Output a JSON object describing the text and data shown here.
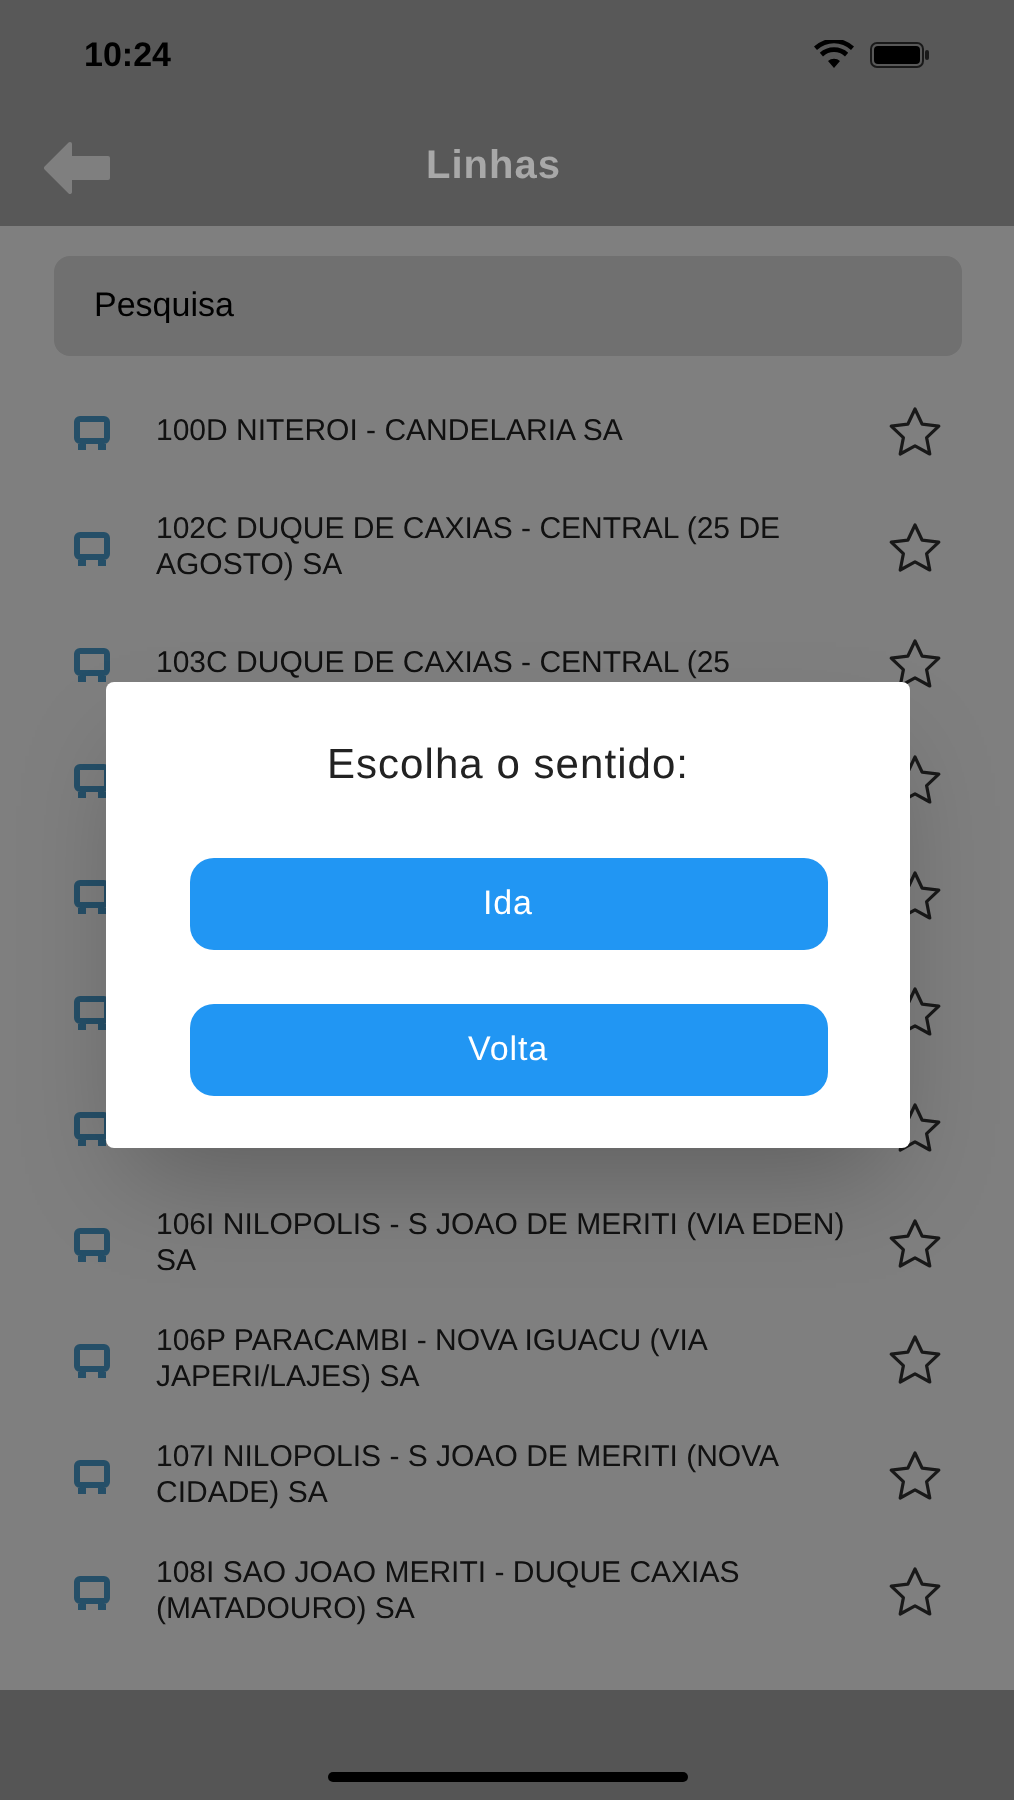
{
  "status_bar": {
    "time": "10:24"
  },
  "header": {
    "title": "Linhas"
  },
  "search": {
    "placeholder": "Pesquisa"
  },
  "lines": [
    {
      "kind": "line",
      "title": "100D NITEROI - CANDELARIA SA"
    },
    {
      "kind": "line",
      "title": "102C DUQUE DE CAXIAS - CENTRAL (25 DE AGOSTO) SA"
    },
    {
      "kind": "line",
      "title": "103C DUQUE DE CAXIAS - CENTRAL (25"
    },
    {
      "kind": "covered"
    },
    {
      "kind": "covered"
    },
    {
      "kind": "covered"
    },
    {
      "kind": "covered"
    },
    {
      "kind": "line",
      "title": "106I NILOPOLIS - S JOAO DE MERITI (VIA EDEN) SA"
    },
    {
      "kind": "line",
      "title": "106P PARACAMBI - NOVA IGUACU (VIA JAPERI/LAJES) SA"
    },
    {
      "kind": "line",
      "title": "107I NILOPOLIS - S JOAO DE MERITI (NOVA CIDADE) SA"
    },
    {
      "kind": "line",
      "title": "108I SAO JOAO MERITI - DUQUE CAXIAS (MATADOURO) SA"
    }
  ],
  "dialog": {
    "title": "Escolha o sentido:",
    "buttons": [
      "Ida",
      "Volta"
    ]
  }
}
